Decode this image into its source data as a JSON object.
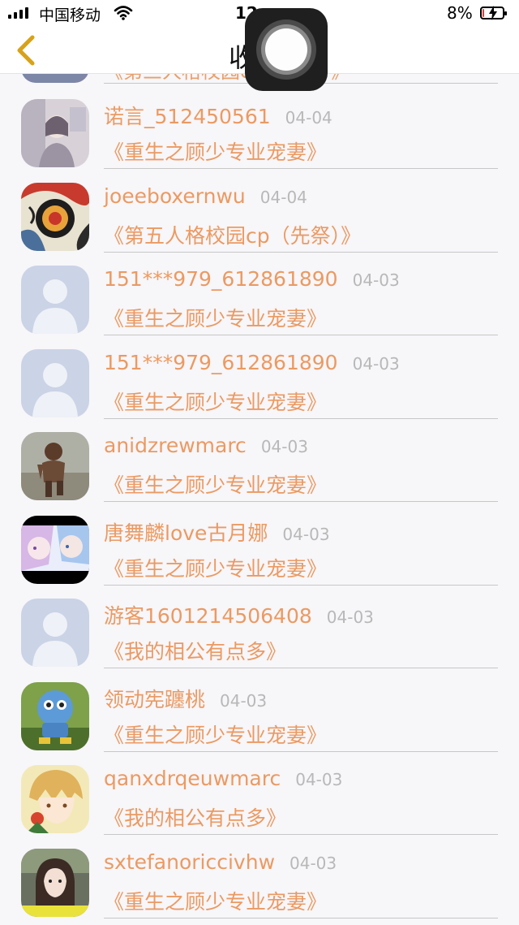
{
  "status_bar": {
    "carrier": "中国移动",
    "time": "12:",
    "battery_percent": "8%",
    "battery_level": 0.08
  },
  "nav": {
    "title": "收"
  },
  "partial_row": {
    "book": "《第三人格校园cp（先祭）》"
  },
  "rows": [
    {
      "name": "诺言_512450561",
      "date": "04-04",
      "book": "《重生之顾少专业宠妻》",
      "avatar": "photo-girl-icon"
    },
    {
      "name": "joeeboxernwu",
      "date": "04-04",
      "book": "《第五人格校园cp（先祭）》",
      "avatar": "abstract-art-icon"
    },
    {
      "name": "151***979_612861890",
      "date": "04-03",
      "book": "《重生之顾少专业宠妻》",
      "avatar": "default-user-icon"
    },
    {
      "name": "151***979_612861890",
      "date": "04-03",
      "book": "《重生之顾少专业宠妻》",
      "avatar": "default-user-icon"
    },
    {
      "name": "anidzrewmarc",
      "date": "04-03",
      "book": "《重生之顾少专业宠妻》",
      "avatar": "photo-child-icon"
    },
    {
      "name": "唐舞麟love古月娜",
      "date": "04-03",
      "book": "《重生之顾少专业宠妻》",
      "avatar": "anime-pair-icon"
    },
    {
      "name": "游客1601214506408",
      "date": "04-03",
      "book": "《我的相公有点多》",
      "avatar": "default-user-icon"
    },
    {
      "name": "领动宪躔桃",
      "date": "04-03",
      "book": "《重生之顾少专业宠妻》",
      "avatar": "robot-toy-icon"
    },
    {
      "name": "qanxdrqeuwmarc",
      "date": "04-03",
      "book": "《我的相公有点多》",
      "avatar": "anime-boy-icon"
    },
    {
      "name": "sxtefanoriccivhw",
      "date": "04-03",
      "book": "《重生之顾少专业宠妻》",
      "avatar": "photo-woman-icon"
    }
  ],
  "colors": {
    "accent": "#eb9a62",
    "date": "#b8b8b8",
    "background": "#f7f6f9",
    "back_arrow": "#d7a21b"
  }
}
